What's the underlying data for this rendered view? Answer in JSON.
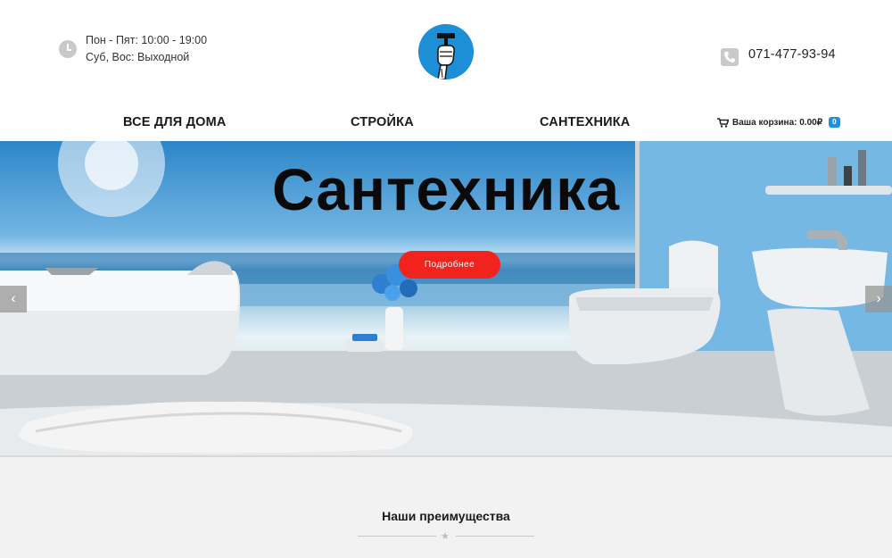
{
  "header": {
    "hours_line1": "Пон - Пят: 10:00 - 19:00",
    "hours_line2": "Суб, Вос: Выходной",
    "phone": "071-477-93-94"
  },
  "nav": {
    "items": [
      {
        "label": "ВСЕ ДЛЯ ДОМА"
      },
      {
        "label": "СТРОЙКА"
      },
      {
        "label": "САНТЕХНИКА"
      }
    ],
    "cart_label": "Ваша корзина: 0.00₽",
    "cart_count": "0"
  },
  "hero": {
    "title": "Сантехника",
    "button_label": "Подробнее",
    "prev_arrow": "‹",
    "next_arrow": "›"
  },
  "advantages": {
    "title": "Наши преимущества",
    "star": "★"
  },
  "colors": {
    "accent_red": "#f2231c",
    "logo_blue": "#1d8fd6",
    "badge_blue": "#1f8fe0"
  }
}
